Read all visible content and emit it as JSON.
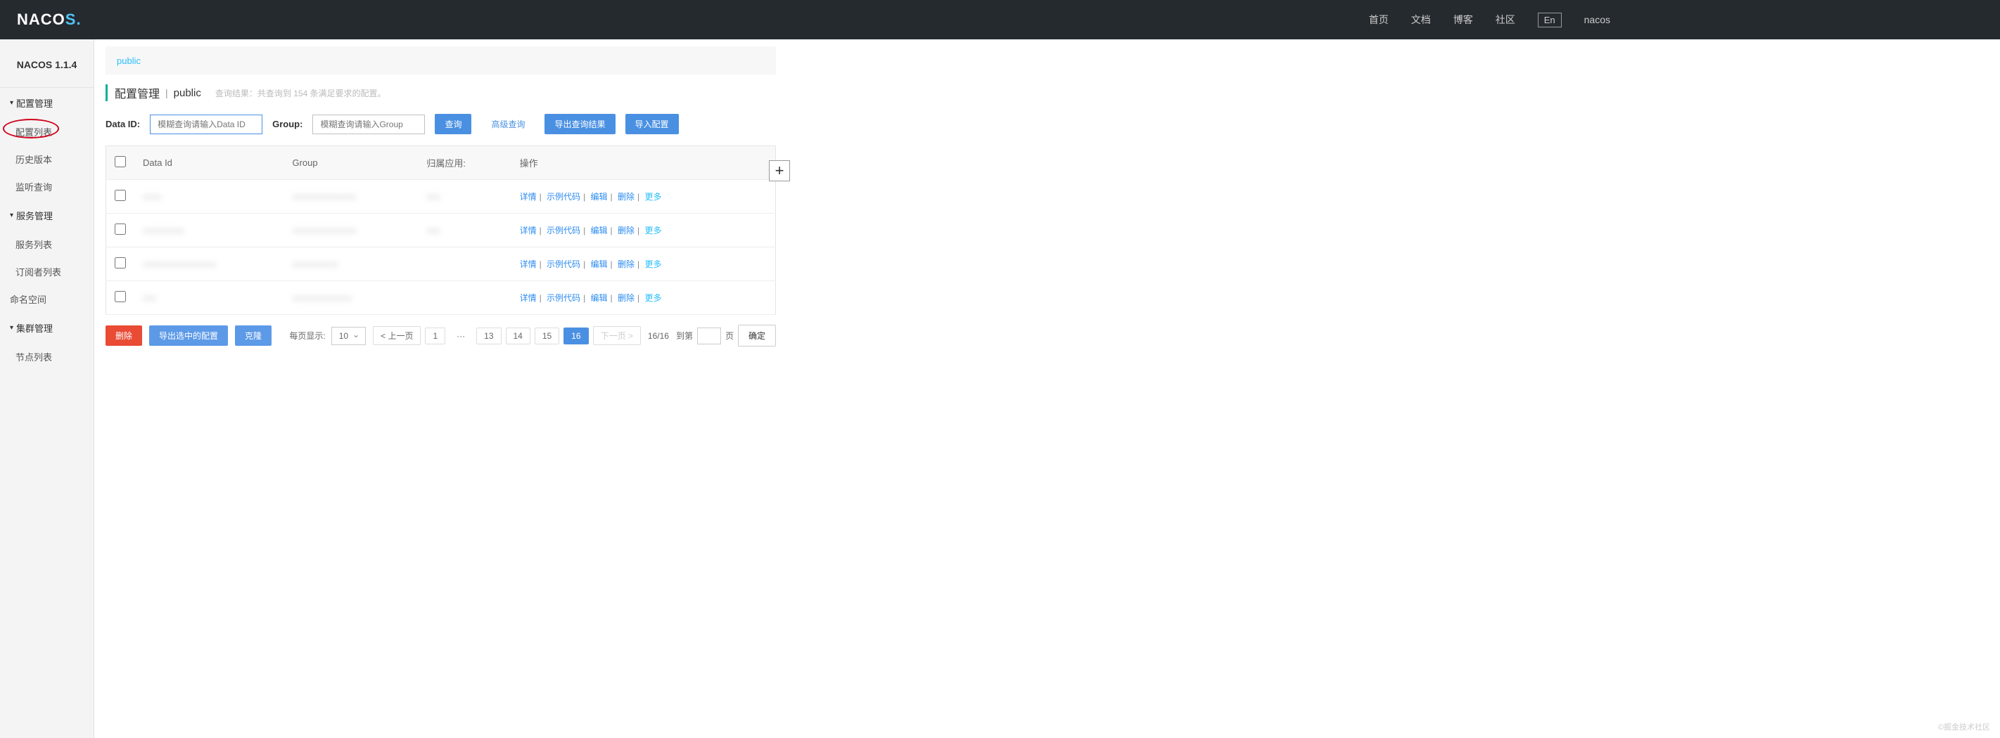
{
  "header": {
    "logo": "NACOS.",
    "nav": [
      "首页",
      "文档",
      "博客",
      "社区"
    ],
    "lang": "En",
    "user": "nacos"
  },
  "sidebar": {
    "version": "NACOS 1.1.4",
    "groups": [
      {
        "title": "配置管理",
        "items": [
          "配置列表",
          "历史版本",
          "监听查询"
        ],
        "active_index": 0
      },
      {
        "title": "服务管理",
        "items": [
          "服务列表",
          "订阅者列表"
        ]
      }
    ],
    "flat_items": [
      "命名空间"
    ],
    "groups2": [
      {
        "title": "集群管理",
        "items": [
          "节点列表"
        ]
      }
    ]
  },
  "main": {
    "namespace_tab": "public",
    "title": "配置管理",
    "title_ns": "public",
    "result_text": "查询结果：共查询到 154 条满足要求的配置。",
    "search": {
      "dataid_label": "Data ID:",
      "dataid_placeholder": "模糊查询请输入Data ID",
      "group_label": "Group:",
      "group_placeholder": "模糊查询请输入Group",
      "query_btn": "查询",
      "adv_query": "高级查询",
      "export_btn": "导出查询结果",
      "import_btn": "导入配置"
    },
    "table": {
      "headers": [
        "Data Id",
        "Group",
        "归属应用:",
        "操作"
      ],
      "rows": [
        {
          "dataid": "xxxx",
          "group": "xxxxxxxxxxxxxx",
          "app": "xxx"
        },
        {
          "dataid": "xxxxxxxxx",
          "group": "xxxxxxxxxxxxxx",
          "app": "xxx"
        },
        {
          "dataid": "xxxxxxxxxxxxxxxx",
          "group": "xxxxxxxxxx",
          "app": ""
        },
        {
          "dataid": "xxx",
          "group": "xxxxxxxxxxxxx",
          "app": ""
        }
      ],
      "actions": {
        "detail": "详情",
        "sample": "示例代码",
        "edit": "编辑",
        "delete": "删除",
        "more": "更多"
      }
    },
    "footer": {
      "delete_btn": "删除",
      "export_selected_btn": "导出选中的配置",
      "clone_btn": "克隆",
      "page_size_label": "每页显示:",
      "page_size": "10",
      "prev": "< 上一页",
      "pages": [
        "1",
        "13",
        "14",
        "15",
        "16"
      ],
      "active_page": "16",
      "next": "下一页 >",
      "total": "16/16",
      "goto_label": "到第",
      "goto_suffix": "页",
      "confirm": "确定"
    }
  },
  "watermark": "©掘金技术社区"
}
